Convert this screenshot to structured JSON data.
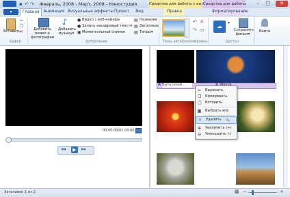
{
  "window": {
    "title": "Февраль, 2008 - Март, 2008 - Киностудия",
    "context_tabs": [
      {
        "label": "Средства для работы с видео",
        "color": "#f6eb9a"
      },
      {
        "label": "Средства для работы с ф",
        "color": "#d9c6ef"
      }
    ],
    "controls": {
      "minimize": "–",
      "maximize": "□",
      "close": "✕"
    }
  },
  "file_button": {
    "label": "▾"
  },
  "tabs": [
    {
      "label": "Главная",
      "active": true
    },
    {
      "label": "Анимация"
    },
    {
      "label": "Визуальные эффекты"
    },
    {
      "label": "Проект"
    },
    {
      "label": "Вид"
    },
    {
      "label": "Правка"
    },
    {
      "label": "Форматирование"
    }
  ],
  "ribbon": {
    "paste": "Вставить",
    "clipboard_group": "Буфер",
    "add_media": "Добавить видео и фотографии",
    "add_music": "Добавить музыку",
    "music_arrow": "▾",
    "webcam": "Видео с веб-камеры",
    "narration": "Запись закадровый текст",
    "narration_arrow": "▾",
    "snapshot": "Моментальный снимок",
    "add_group": "Добавление",
    "title_btn": "Название",
    "caption_btn": "Заголовок",
    "credits_btn": "Титры",
    "credits_arrow": "▾",
    "automovie_group": "Темы автофильма",
    "edit_group": "Правка",
    "share_group": "Доступ",
    "save_movie": "Сохранить фильм",
    "save_arrow": "▾",
    "signin": "Войти"
  },
  "player": {
    "timecode": "00:00,00/01:03,00"
  },
  "storyboard": {
    "clip_caption_1": "Выпускной",
    "clip_caption_2": "Мечта"
  },
  "context_menu": {
    "items": [
      {
        "label": "Вырезать",
        "icon": "scissors-icon",
        "glyph": "✂",
        "state": "normal"
      },
      {
        "label": "Копировать",
        "icon": "copy-icon",
        "glyph": "❐",
        "state": "normal"
      },
      {
        "label": "Вставить",
        "icon": "paste-icon",
        "glyph": "📋",
        "state": "normal"
      },
      {
        "label": "Выбрать все",
        "icon": "select-all-icon",
        "glyph": "▦",
        "state": "normal"
      },
      {
        "label": "Удалить",
        "icon": "delete-icon",
        "glyph": "✕",
        "state": "highlighted"
      },
      {
        "label": "Увеличить (+)",
        "icon": "zoom-in-icon",
        "glyph": "⊕",
        "state": "normal"
      },
      {
        "label": "Уменьшить (-)",
        "icon": "zoom-out-icon",
        "glyph": "⊖",
        "state": "normal"
      }
    ]
  },
  "status": {
    "text": "Заголовок 1 из 2"
  },
  "colors": {
    "accent": "#1f5fb3",
    "highlight": "#d4e6f8"
  }
}
